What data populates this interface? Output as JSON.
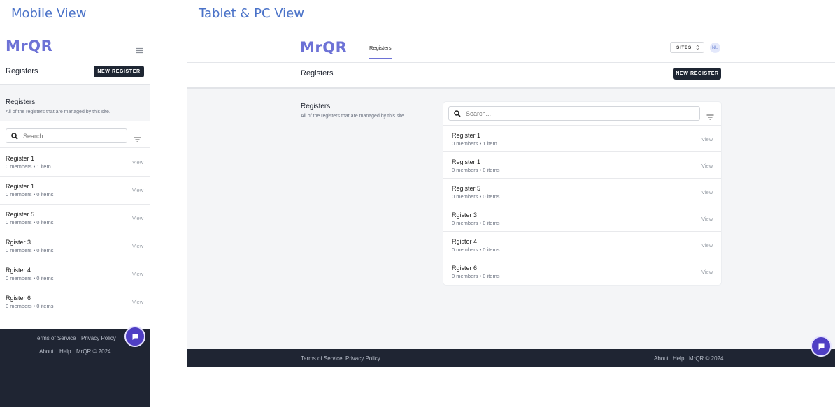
{
  "captions": {
    "mobile": "Mobile View",
    "desktop": "Tablet & PC View"
  },
  "brand": {
    "logo": "MrQR",
    "color": "#6d72d6"
  },
  "nav": {
    "tab_registers": "Registers",
    "sites_label": "SITES",
    "sites_icon": "chevron-updown-icon",
    "avatar_initials": "NU"
  },
  "header": {
    "title": "Registers",
    "new_button": "NEW REGISTER"
  },
  "section": {
    "title": "Registers",
    "description": "All of the registers that are managed by this site."
  },
  "search": {
    "placeholder": "Search..."
  },
  "registers": [
    {
      "name": "Register 1",
      "meta": "0 members • 1 item",
      "action": "View"
    },
    {
      "name": "Register 1",
      "meta": "0 members • 0 items",
      "action": "View"
    },
    {
      "name": "Register 5",
      "meta": "0 members • 0 items",
      "action": "View"
    },
    {
      "name": "Rgister 3",
      "meta": "0 members • 0 items",
      "action": "View"
    },
    {
      "name": "Rgister 4",
      "meta": "0 members • 0 items",
      "action": "View"
    },
    {
      "name": "Rgister 6",
      "meta": "0 members • 0 items",
      "action": "View"
    }
  ],
  "footer": {
    "terms": "Terms of Service",
    "privacy": "Privacy Policy",
    "about": "About",
    "help": "Help",
    "copyright": "MrQR © 2024"
  },
  "colors": {
    "accent": "#6d72d6",
    "dark": "#1e2633",
    "chat": "#4f3fc4"
  }
}
